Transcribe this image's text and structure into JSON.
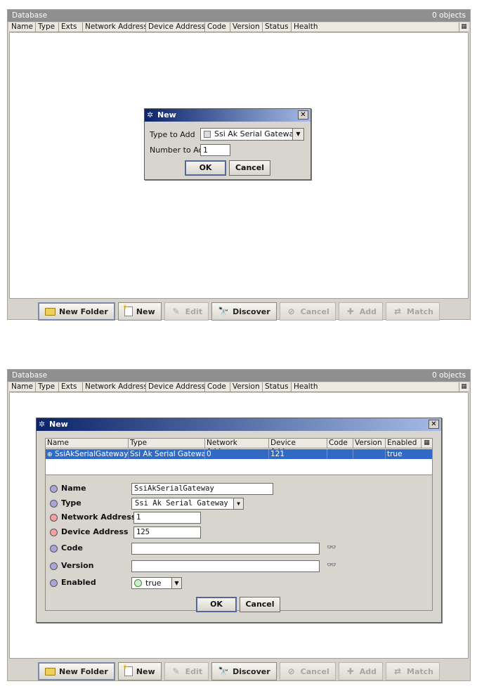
{
  "colors": {
    "title_bar": "#8f8f8f",
    "dialog_title": "#0b246a",
    "selection": "#316ac5",
    "required_dot": "#f4a0a0",
    "optional_dot": "#a9a5da"
  },
  "database": {
    "title": "Database",
    "count": "0 objects",
    "columns": [
      "Name",
      "Type",
      "Exts",
      "Network Address",
      "Device Address",
      "Code",
      "Version",
      "Status",
      "Health"
    ],
    "corner_icon": "column-chooser-icon"
  },
  "toolbar": {
    "new_folder": "New Folder",
    "new": "New",
    "edit": "Edit",
    "discover": "Discover",
    "cancel": "Cancel",
    "add": "Add",
    "match": "Match"
  },
  "dialog1": {
    "title": "New",
    "type_label": "Type to Add",
    "type_value": "Ssi Ak Serial Gateway",
    "number_label": "Number to Add",
    "number_value": "1",
    "ok": "OK",
    "cancel": "Cancel"
  },
  "dialog2": {
    "title": "New",
    "table_columns": [
      "Name",
      "Type",
      "Network Address",
      "Device Address",
      "Code",
      "Version",
      "Enabled"
    ],
    "table_row": [
      "SsiAkSerialGateway",
      "Ssi Ak Serial Gateway",
      "0",
      "121",
      "",
      "",
      "true"
    ],
    "props": {
      "name_label": "Name",
      "name_value": "SsiAkSerialGateway",
      "type_label": "Type",
      "type_value": "Ssi Ak Serial Gateway",
      "network_label": "Network Address",
      "network_value": "1",
      "device_label": "Device Address",
      "device_value": "125",
      "code_label": "Code",
      "code_value": "",
      "version_label": "Version",
      "version_value": "",
      "enabled_label": "Enabled",
      "enabled_value": "true"
    },
    "ok": "OK",
    "cancel": "Cancel"
  }
}
